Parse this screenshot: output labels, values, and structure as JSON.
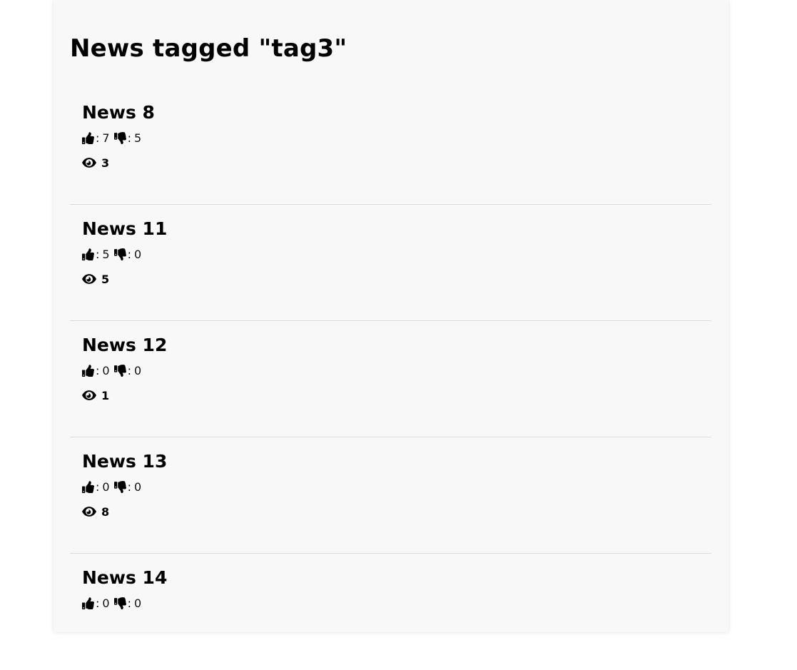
{
  "page": {
    "title": "News tagged \"tag3\""
  },
  "news": [
    {
      "title": "News 8",
      "likes": "7",
      "dislikes": "5",
      "views": "3"
    },
    {
      "title": "News 11",
      "likes": "5",
      "dislikes": "0",
      "views": "5"
    },
    {
      "title": "News 12",
      "likes": "0",
      "dislikes": "0",
      "views": "1"
    },
    {
      "title": "News 13",
      "likes": "0",
      "dislikes": "0",
      "views": "8"
    },
    {
      "title": "News 14",
      "likes": "0",
      "dislikes": "0",
      "views": ""
    }
  ],
  "labels": {
    "separator": ":"
  },
  "icons": {
    "like": "thumbs-up-icon",
    "dislike": "thumbs-down-icon",
    "views": "eye-icon"
  }
}
